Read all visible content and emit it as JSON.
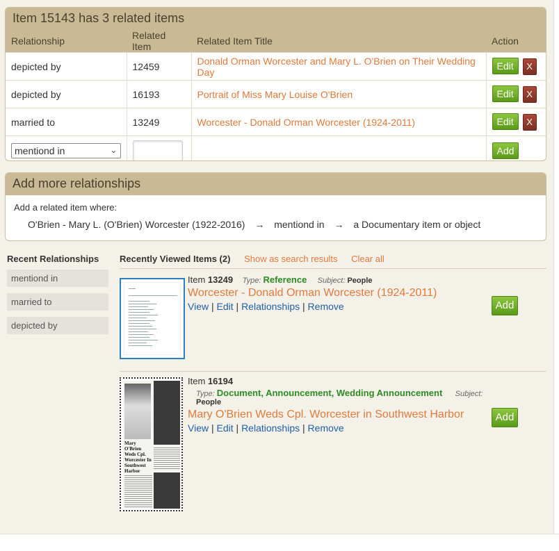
{
  "related_panel": {
    "title": "Item 15143 has 3 related items",
    "headers": [
      "Relationship",
      "Related Item",
      "Related Item Title",
      "Action"
    ],
    "rows": [
      {
        "relationship": "depicted by",
        "item": "12459",
        "title": "Donald Orman Worcester and Mary L. O'Brien on Their Wedding Day"
      },
      {
        "relationship": "depicted by",
        "item": "16193",
        "title": "Portrait of Miss Mary Louise O'Brien"
      },
      {
        "relationship": "married to",
        "item": "13249",
        "title": "Worcester - Donald Orman Worcester (1924-2011)"
      }
    ],
    "edit_label": "Edit",
    "delete_label": "X",
    "new_row": {
      "selected_relationship": "mentiond in",
      "item_value": "",
      "add_label": "Add"
    }
  },
  "more_panel": {
    "title": "Add more relationships",
    "intro": "Add a related item where:",
    "subject": "O'Brien - Mary L. (O'Brien) Worcester (1922-2016)",
    "arrow": "→",
    "relationship": "mentiond in",
    "object": "a Documentary item or object"
  },
  "recent_relationships": {
    "title": "Recent Relationships",
    "items": [
      "mentiond in",
      "married to",
      "depicted by"
    ]
  },
  "recent_items": {
    "title": "Recently Viewed Items (2)",
    "show_search": "Show as search results",
    "clear_all": "Clear all",
    "item_label": "Item",
    "type_label": "Type:",
    "subject_label": "Subject:",
    "links": {
      "view": "View",
      "edit": "Edit",
      "relationships": "Relationships",
      "remove": "Remove"
    },
    "add_label": "Add",
    "items": [
      {
        "number": "13249",
        "type": "Reference",
        "subject": "People",
        "title": "Worcester - Donald Orman Worcester (1924-2011)"
      },
      {
        "number": "16194",
        "type": "Document, Announcement, Wedding Announcement",
        "subject": "People",
        "title": "Mary O'Brien Weds Cpl. Worcester in Southwest Harbor",
        "thumb_headline": "Mary O'Brien Weds Cpl. Worcester In Southwest Harbor"
      }
    ]
  }
}
